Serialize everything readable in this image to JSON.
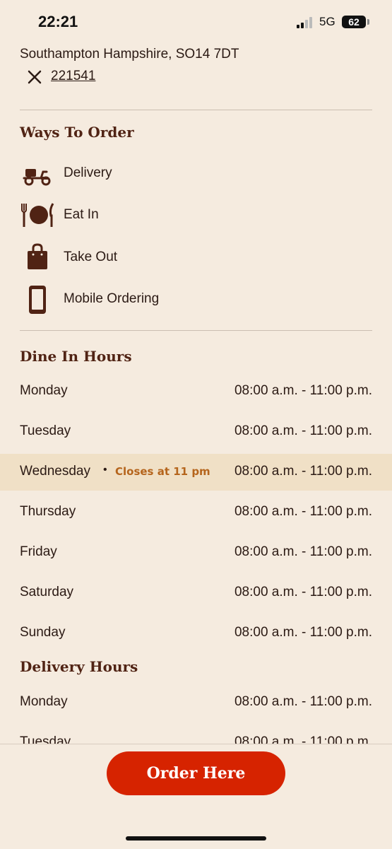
{
  "status_bar": {
    "time": "22:21",
    "network": "5G",
    "battery": "62"
  },
  "store": {
    "address": "Southampton Hampshire, SO14 7DT",
    "store_id": "221541"
  },
  "ways_to_order": {
    "title": "Ways To Order",
    "items": [
      {
        "label": "Delivery",
        "icon": "scooter-icon"
      },
      {
        "label": "Eat In",
        "icon": "fork-plate-knife-icon"
      },
      {
        "label": "Take Out",
        "icon": "shopping-bag-icon"
      },
      {
        "label": "Mobile Ordering",
        "icon": "smartphone-icon"
      }
    ]
  },
  "dine_in_hours": {
    "title": "Dine In Hours",
    "today_note": "Closes at 11 pm",
    "days": [
      {
        "day": "Monday",
        "hours": "08:00 a.m. - 11:00 p.m."
      },
      {
        "day": "Tuesday",
        "hours": "08:00 a.m. - 11:00 p.m."
      },
      {
        "day": "Wednesday",
        "hours": "08:00 a.m. - 11:00 p.m."
      },
      {
        "day": "Thursday",
        "hours": "08:00 a.m. - 11:00 p.m."
      },
      {
        "day": "Friday",
        "hours": "08:00 a.m. - 11:00 p.m."
      },
      {
        "day": "Saturday",
        "hours": "08:00 a.m. - 11:00 p.m."
      },
      {
        "day": "Sunday",
        "hours": "08:00 a.m. - 11:00 p.m."
      }
    ]
  },
  "delivery_hours": {
    "title": "Delivery Hours",
    "days": [
      {
        "day": "Monday",
        "hours": "08:00 a.m. - 11:00 p.m."
      },
      {
        "day": "Tuesday",
        "hours": "08:00 a.m. - 11:00 p.m."
      }
    ]
  },
  "cta": {
    "label": "Order Here"
  },
  "colors": {
    "background": "#f5ebdf",
    "text": "#502314",
    "accent": "#d62300",
    "today_highlight": "#f0e0c6",
    "closes_note": "#b5651d"
  }
}
